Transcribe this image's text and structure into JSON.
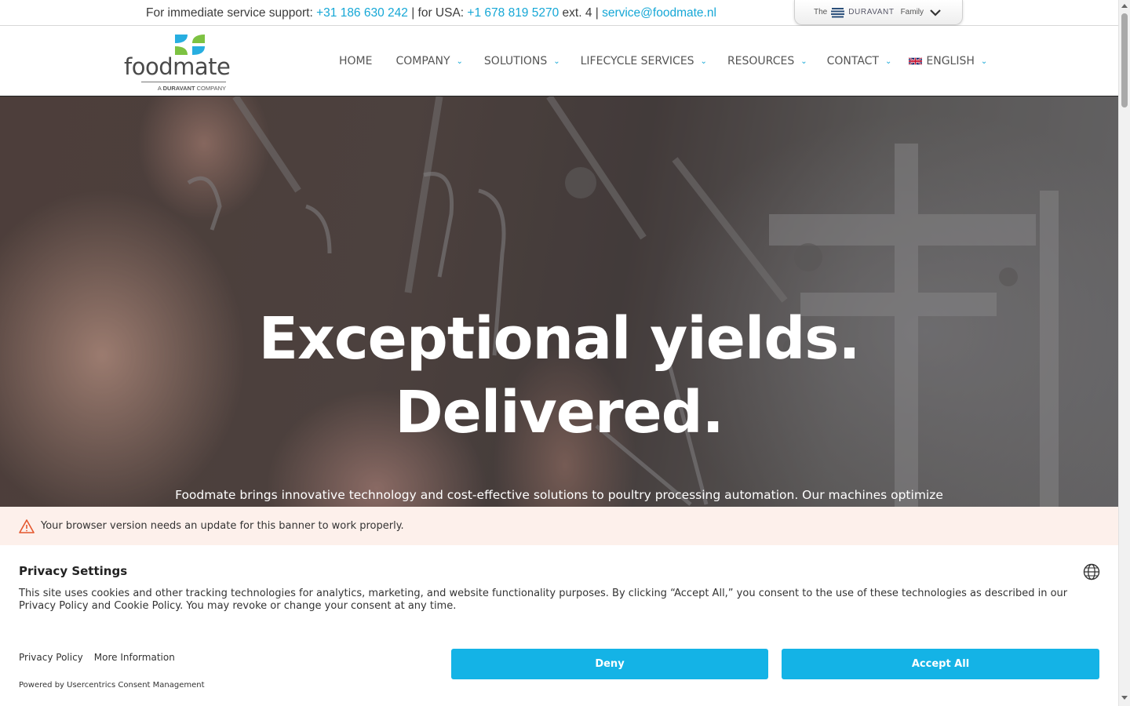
{
  "topbar": {
    "support_prefix": "For immediate service support:",
    "phone_nl": "+31 186 630 242",
    "sep_usa": " | for USA: ",
    "phone_usa": "+1 678 819 5270",
    "ext": " ext. 4 | ",
    "email": "service@foodmate.nl",
    "family_the": "The",
    "family_brand": "DURAVANT",
    "family_word": "Family"
  },
  "logo": {
    "brand": "foodmate",
    "sub_prefix": "A",
    "sub_bold": "DURAVANT",
    "sub_suffix": "COMPANY"
  },
  "nav": {
    "items": [
      {
        "label": "HOME"
      },
      {
        "label": "COMPANY"
      },
      {
        "label": "SOLUTIONS"
      },
      {
        "label": "LIFECYCLE SERVICES"
      },
      {
        "label": "RESOURCES"
      },
      {
        "label": "CONTACT"
      },
      {
        "label": "ENGLISH"
      }
    ]
  },
  "hero": {
    "line1": "Exceptional yields.",
    "line2": "Delivered.",
    "text": "Foodmate brings innovative technology and cost-effective solutions to poultry processing automation. Our machines optimize"
  },
  "consent": {
    "warning": "Your browser version needs an update for this banner to work properly.",
    "title": "Privacy Settings",
    "message": "This site uses cookies and other tracking technologies for analytics, marketing, and website functionality purposes. By clicking “Accept All,” you consent to the use of these technologies as described in our Privacy Policy and Cookie Policy. You may revoke or change your consent at any time.",
    "privacy_link": "Privacy Policy",
    "more_info_link": "More Information",
    "powered_by": "Powered by Usercentrics Consent Management",
    "deny_label": "Deny",
    "accept_label": "Accept All"
  },
  "colors": {
    "accent": "#14b3e6",
    "link": "#15a7d6",
    "warning_bg": "#fdf0eb"
  }
}
